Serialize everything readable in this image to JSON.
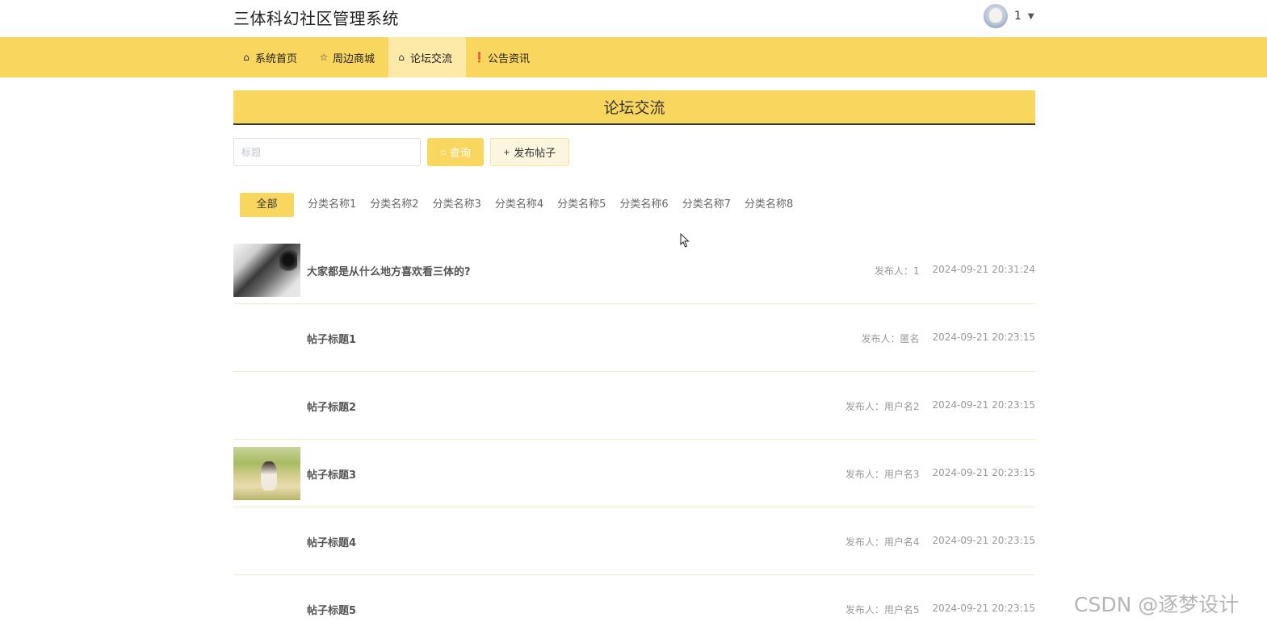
{
  "app": {
    "title": "三体科幻社区管理系统"
  },
  "user": {
    "name": "1",
    "caret": "▼"
  },
  "nav": {
    "items": [
      {
        "label": "系统首页",
        "icon": "home-icon",
        "glyph": "⌂"
      },
      {
        "label": "周边商城",
        "icon": "star-icon",
        "glyph": "☆"
      },
      {
        "label": "论坛交流",
        "icon": "bag-icon",
        "glyph": "⌂"
      },
      {
        "label": "公告资讯",
        "icon": "info-icon",
        "glyph": "❗"
      }
    ],
    "active_index": 2
  },
  "section": {
    "title": "论坛交流"
  },
  "search": {
    "placeholder": "标题",
    "value": ""
  },
  "buttons": {
    "query": {
      "label": "查询",
      "icon": "search-icon",
      "glyph": "○"
    },
    "publish": {
      "label": "发布帖子",
      "icon": "plus-icon",
      "glyph": "+"
    }
  },
  "categories": {
    "items": [
      "全部",
      "分类名称1",
      "分类名称2",
      "分类名称3",
      "分类名称4",
      "分类名称5",
      "分类名称6",
      "分类名称7",
      "分类名称8"
    ],
    "active_index": 0
  },
  "posts": [
    {
      "title": "大家都是从什么地方喜欢看三体的?",
      "author": "发布人：1",
      "time": "2024-09-21 20:31:24",
      "thumb": "ink"
    },
    {
      "title": "帖子标题1",
      "author": "发布人：匿名",
      "time": "2024-09-21 20:23:15",
      "thumb": ""
    },
    {
      "title": "帖子标题2",
      "author": "发布人：用户名2",
      "time": "2024-09-21 20:23:15",
      "thumb": ""
    },
    {
      "title": "帖子标题3",
      "author": "发布人：用户名3",
      "time": "2024-09-21 20:23:15",
      "thumb": "park"
    },
    {
      "title": "帖子标题4",
      "author": "发布人：用户名4",
      "time": "2024-09-21 20:23:15",
      "thumb": ""
    },
    {
      "title": "帖子标题5",
      "author": "发布人：用户名5",
      "time": "2024-09-21 20:23:15",
      "thumb": ""
    }
  ],
  "watermark": "CSDN @逐梦设计",
  "colors": {
    "accent": "#f9d65e",
    "nav_active": "#fde9a8",
    "divider": "#f3ecc6"
  }
}
